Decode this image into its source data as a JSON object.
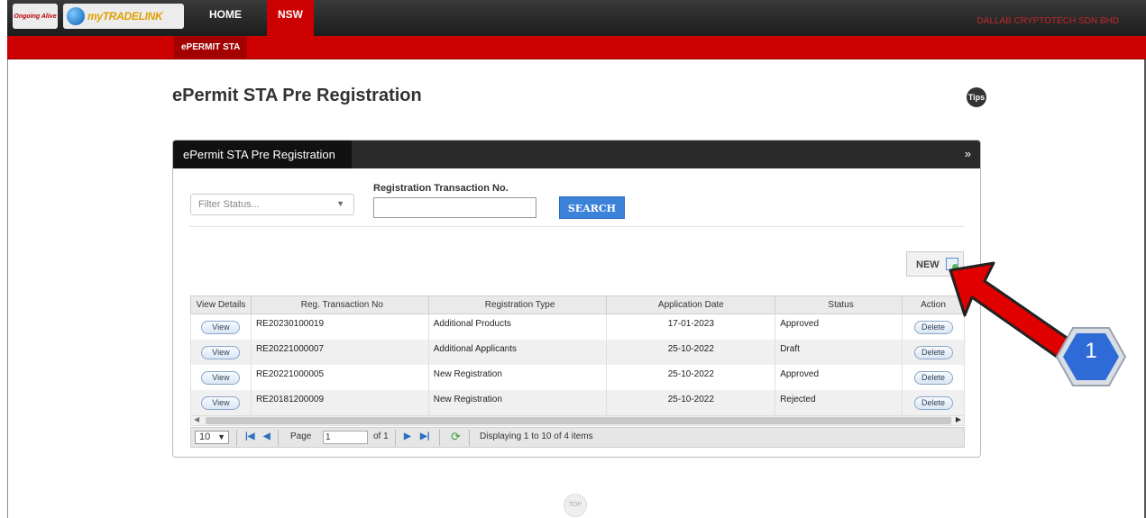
{
  "header": {
    "logo_left_text": "Ongoing Alive",
    "logo_brand": "myTRADELINK",
    "nav": [
      {
        "label": "HOME"
      },
      {
        "label": "NSW"
      }
    ],
    "company": "DALLAB CRYPTOTECH SDN BHD",
    "subnav": [
      {
        "label": "ePERMIT STA"
      }
    ]
  },
  "page": {
    "title": "ePermit STA Pre Registration",
    "tips_label": "Tips"
  },
  "panel": {
    "title": "ePermit STA Pre Registration",
    "filter_placeholder": "Filter Status...",
    "reg_label": "Registration Transaction No.",
    "reg_value": "",
    "search_label": "SEARCH",
    "new_label": "NEW"
  },
  "table": {
    "columns": [
      "View Details",
      "Reg. Transaction No",
      "Registration Type",
      "Application Date",
      "Status",
      "Action"
    ],
    "view_label": "View",
    "delete_label": "Delete",
    "rows": [
      {
        "reg_no": "RE20230100019",
        "type": "Additional Products",
        "date": "17-01-2023",
        "status": "Approved"
      },
      {
        "reg_no": "RE20221000007",
        "type": "Additional Applicants",
        "date": "25-10-2022",
        "status": "Draft"
      },
      {
        "reg_no": "RE20221000005",
        "type": "New Registration",
        "date": "25-10-2022",
        "status": "Approved"
      },
      {
        "reg_no": "RE20181200009",
        "type": "New Registration",
        "date": "25-10-2022",
        "status": "Rejected"
      }
    ]
  },
  "pager": {
    "page_size": "10",
    "page_label": "Page",
    "page_value": "1",
    "of_label": "of 1",
    "display_text": "Displaying 1 to 10 of 4 items"
  },
  "footer": {
    "top_label": "TOP"
  },
  "annotation": {
    "number": "1",
    "arrow_color": "#e00000",
    "badge_color": "#2e6bd6"
  }
}
